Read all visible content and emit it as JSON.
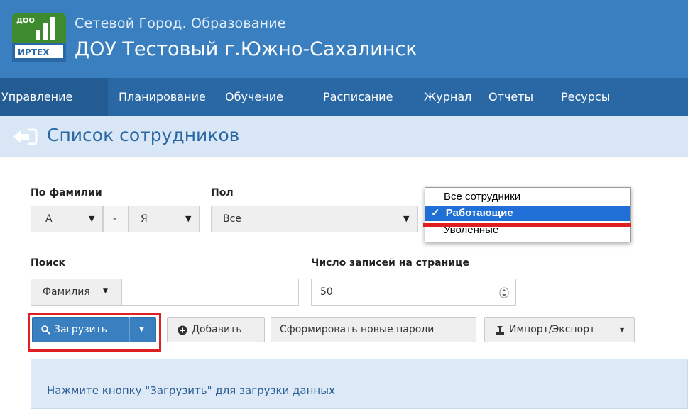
{
  "colors": {
    "header": "#3a7fbf",
    "menu": "#2a68a5",
    "menu_active": "#235c93",
    "page_bar": "#d9e6f5",
    "primary_button": "#3a80c0",
    "highlight": "#e02020",
    "dropdown_selected": "#1f6fd6",
    "info_bg": "#dde9f6"
  },
  "header": {
    "logo_top": "ДОО",
    "logo_bottom": "ИРТЕХ",
    "app_subtitle": "Сетевой Город. Образование",
    "app_title": "ДОУ Тестовый г.Южно-Сахалинск"
  },
  "menu": {
    "items": [
      "Управление",
      "Планирование",
      "Обучение",
      "Расписание",
      "Журнал",
      "Отчеты",
      "Ресурсы"
    ]
  },
  "page": {
    "title": "Список сотрудников"
  },
  "filters": {
    "surname_label": "По фамилии",
    "surname_from": "А",
    "surname_dash": "-",
    "surname_to": "Я",
    "gender_label": "Пол",
    "gender_value": "Все",
    "search_label": "Поиск",
    "search_by": "Фамилия",
    "search_value": "",
    "page_size_label": "Число записей на странице",
    "page_size_value": "50"
  },
  "status_dropdown": {
    "options": [
      "Все сотрудники",
      "Работающие",
      "Уволенные"
    ],
    "selected": "Работающие",
    "check_mark": "✓"
  },
  "toolbar": {
    "load_label": "Загрузить",
    "add_label": "Добавить",
    "new_passwords_label": "Сформировать новые пароли",
    "import_export_label": "Импорт/Экспорт"
  },
  "info": {
    "message": "Нажмите кнопку \"Загрузить\" для загрузки данных"
  }
}
